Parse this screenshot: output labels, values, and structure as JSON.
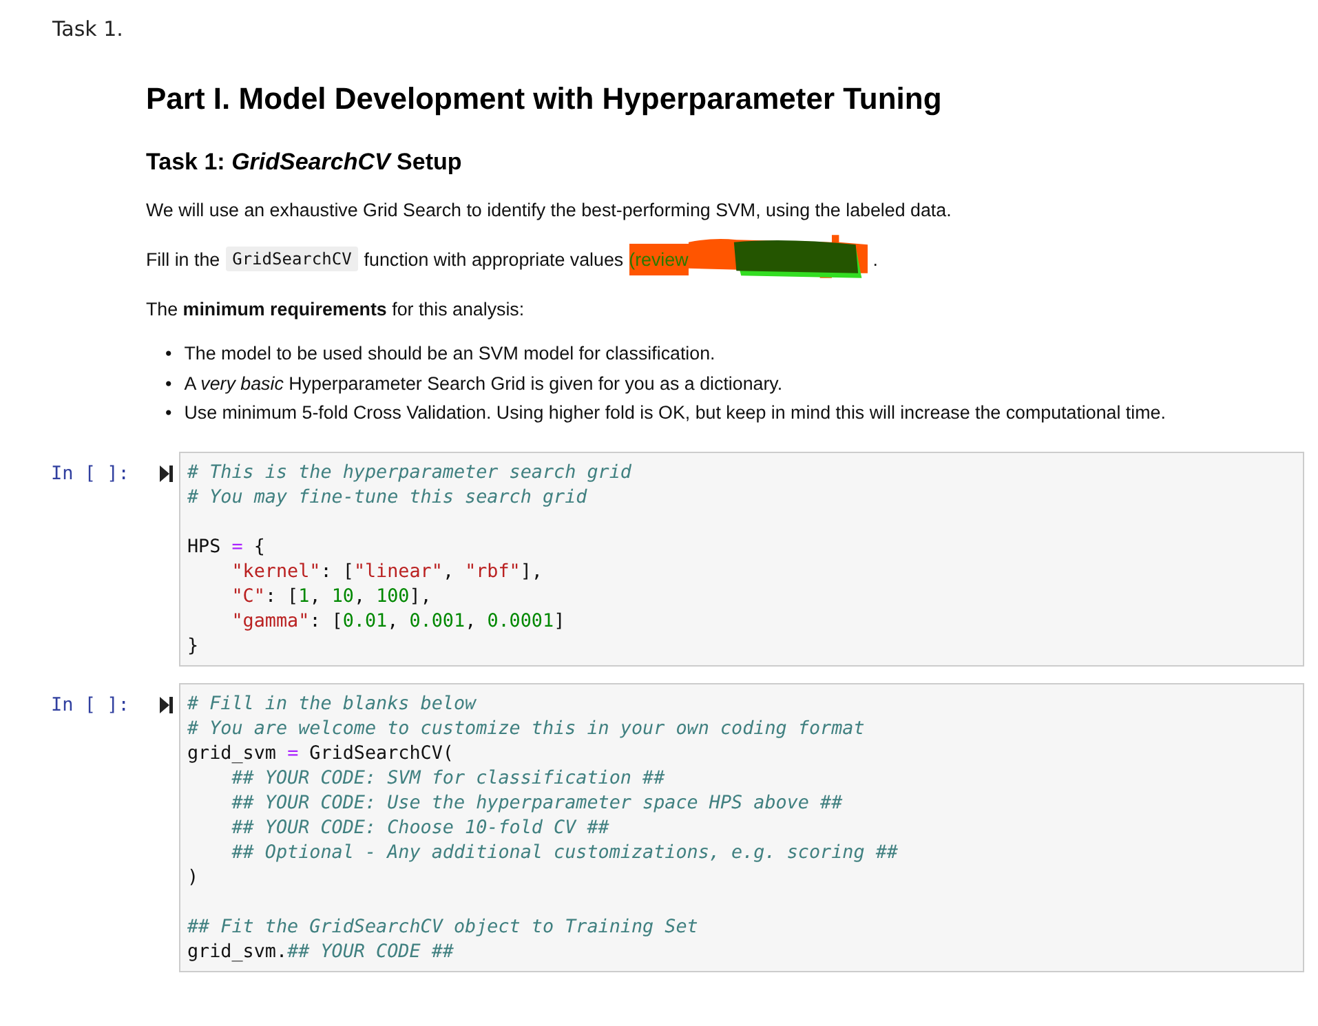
{
  "page_label": "Task 1.",
  "heading": "Part I. Model Development with Hyperparameter Tuning",
  "subheading": {
    "italic_part": "GridSearchCV",
    "rest": " Setup",
    "prefix": "Task 1: "
  },
  "intro": "We will use an exhaustive Grid Search to identify the best-performing SVM, using the labeled data.",
  "fill_line": {
    "before": "Fill in the",
    "code": "GridSearchCV",
    "after": "function with appropriate values",
    "visible_tail": "(review",
    "end": "."
  },
  "requirements_intro": "The **minimum requirements** for this analysis:",
  "bullets": [
    {
      "marker": "•",
      "text": "The model to be used should be an SVM model for classification."
    },
    {
      "marker": "•",
      "text": "A *very basic* Hyperparameter Search Grid is given for you as a dictionary."
    },
    {
      "marker": "•",
      "text": "Use minimum 5-fold Cross Validation. Using higher fold is OK, but keep in mind this will increase the computational time."
    }
  ],
  "cells": [
    {
      "prompt": "In [ ]:",
      "lines": [
        [
          {
            "kind": "comment",
            "text": "# This is the hyperparameter search grid"
          }
        ],
        [
          {
            "kind": "comment",
            "text": "# You may fine-tune this search grid"
          }
        ],
        [
          {
            "kind": "blank_line"
          },
          {
            "kind": "name",
            "text": "HPS "
          },
          {
            "kind": "op",
            "text": "="
          },
          {
            "kind": "name",
            "text": " {"
          }
        ],
        [
          {
            "kind": "string",
            "text": "    \"kernel\""
          },
          {
            "kind": "name",
            "text": ": ["
          },
          {
            "kind": "string",
            "text": "\"linear\""
          },
          {
            "kind": "name",
            "text": ", "
          },
          {
            "kind": "string",
            "text": "\"rbf\""
          },
          {
            "kind": "name",
            "text": "],"
          }
        ],
        [
          {
            "kind": "string",
            "text": "    \"C\""
          },
          {
            "kind": "name",
            "text": ": ["
          },
          {
            "kind": "number",
            "text": "1"
          },
          {
            "kind": "name",
            "text": ", "
          },
          {
            "kind": "number",
            "text": "10"
          },
          {
            "kind": "name",
            "text": ", "
          },
          {
            "kind": "number",
            "text": "100"
          },
          {
            "kind": "name",
            "text": "],"
          }
        ],
        [
          {
            "kind": "string",
            "text": "    \"gamma\""
          },
          {
            "kind": "name",
            "text": ": ["
          },
          {
            "kind": "number",
            "text": "0.01"
          },
          {
            "kind": "name",
            "text": ", "
          },
          {
            "kind": "number",
            "text": "0.001"
          },
          {
            "kind": "name",
            "text": ", "
          },
          {
            "kind": "number",
            "text": "0.0001"
          },
          {
            "kind": "name",
            "text": "]"
          }
        ],
        [
          {
            "kind": "name",
            "text": "}"
          }
        ]
      ]
    },
    {
      "prompt": "In [ ]:",
      "lines": [
        [
          {
            "kind": "comment",
            "text": "# Fill in the blanks below"
          }
        ],
        [
          {
            "kind": "comment",
            "text": "# You are welcome to customize this in your own coding format"
          }
        ],
        [
          {
            "kind": "name",
            "text": "grid_svm "
          },
          {
            "kind": "op",
            "text": "="
          },
          {
            "kind": "name",
            "text": " GridSearchCV("
          }
        ],
        [
          {
            "kind": "comment",
            "text": "    ## YOUR CODE: SVM for classification ##"
          }
        ],
        [
          {
            "kind": "comment",
            "text": "    ## YOUR CODE: Use the hyperparameter space HPS above ##"
          }
        ],
        [
          {
            "kind": "comment",
            "text": "    ## YOUR CODE: Choose 10-fold CV ##"
          }
        ],
        [
          {
            "kind": "comment",
            "text": "    ## Optional - Any additional customizations, e.g. scoring ##"
          }
        ],
        [
          {
            "kind": "name",
            "text": ")"
          }
        ],
        [
          {
            "kind": "blank_line"
          },
          {
            "kind": "comment",
            "text": "## Fit the GridSearchCV object to Training Set"
          }
        ],
        [
          {
            "kind": "name",
            "text": "grid_svm."
          },
          {
            "kind": "comment",
            "text": "## YOUR CODE ##"
          }
        ]
      ]
    }
  ]
}
